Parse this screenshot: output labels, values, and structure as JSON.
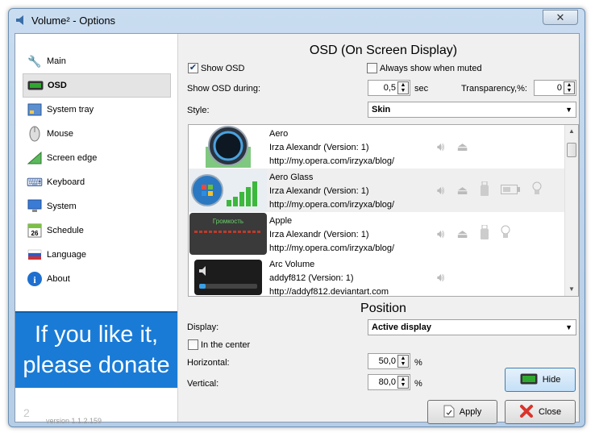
{
  "window": {
    "title": "Volume² - Options",
    "close_glyph": "✕"
  },
  "sidebar": {
    "items": [
      {
        "label": "Main",
        "icon": "wrench-icon",
        "glyph": "🔧"
      },
      {
        "label": "OSD",
        "icon": "osd-icon",
        "glyph": "▬"
      },
      {
        "label": "System tray",
        "icon": "system-tray-icon",
        "glyph": "▦"
      },
      {
        "label": "Mouse",
        "icon": "mouse-icon",
        "glyph": "🖱"
      },
      {
        "label": "Screen edge",
        "icon": "screen-edge-icon",
        "glyph": "◢"
      },
      {
        "label": "Keyboard",
        "icon": "keyboard-icon",
        "glyph": "⌨"
      },
      {
        "label": "System",
        "icon": "system-icon",
        "glyph": "🖥"
      },
      {
        "label": "Schedule",
        "icon": "calendar-icon",
        "glyph": "26"
      },
      {
        "label": "Language",
        "icon": "flag-icon",
        "glyph": "⚑"
      },
      {
        "label": "About",
        "icon": "info-icon",
        "glyph": "i"
      }
    ],
    "selected": "OSD",
    "donate_line1": "If you like it,",
    "donate_line2": "please donate",
    "version": "version 1.1.2.159",
    "version_logo": "2"
  },
  "osd": {
    "title": "OSD (On Screen Display)",
    "show_osd_label": "Show OSD",
    "show_osd_checked": true,
    "always_show_muted_label": "Always show when muted",
    "always_show_muted_checked": false,
    "show_during_label": "Show OSD during:",
    "show_during_value": "0,5",
    "show_during_unit": "sec",
    "transparency_label": "Transparency,%:",
    "transparency_value": "0",
    "style_label": "Style:",
    "style_value": "Skin"
  },
  "skins": [
    {
      "name": "Aero",
      "author": "Irza Alexandr (Version: 1)",
      "url": "http://my.opera.com/irzyxa/blog/",
      "features": [
        "speaker-icon",
        "eject-icon"
      ]
    },
    {
      "name": "Aero Glass",
      "author": "Irza Alexandr (Version: 1)",
      "url": "http://my.opera.com/irzyxa/blog/",
      "features": [
        "speaker-icon",
        "eject-icon",
        "usb-icon",
        "battery-icon",
        "bulb-icon"
      ]
    },
    {
      "name": "Apple",
      "author": "Irza Alexandr (Version: 1)",
      "url": "http://my.opera.com/irzyxa/blog/",
      "thumb_text": "Громкость",
      "features": [
        "speaker-icon",
        "eject-icon",
        "usb-icon",
        "bulb-icon"
      ]
    },
    {
      "name": "Arc Volume",
      "author": "addyf812 (Version: 1)",
      "url": "http://addyf812.deviantart.com",
      "features": [
        "speaker-icon"
      ]
    }
  ],
  "position": {
    "title": "Position",
    "display_label": "Display:",
    "display_value": "Active display",
    "in_center_label": "In the center",
    "in_center_checked": false,
    "horizontal_label": "Horizontal:",
    "horizontal_value": "50,0",
    "vertical_label": "Vertical:",
    "vertical_value": "80,0",
    "percent": "%"
  },
  "buttons": {
    "hide": "Hide",
    "apply": "Apply",
    "close": "Close"
  },
  "colors": {
    "donate_bg": "#1a7bd6",
    "accent_green": "#2fa82f"
  }
}
